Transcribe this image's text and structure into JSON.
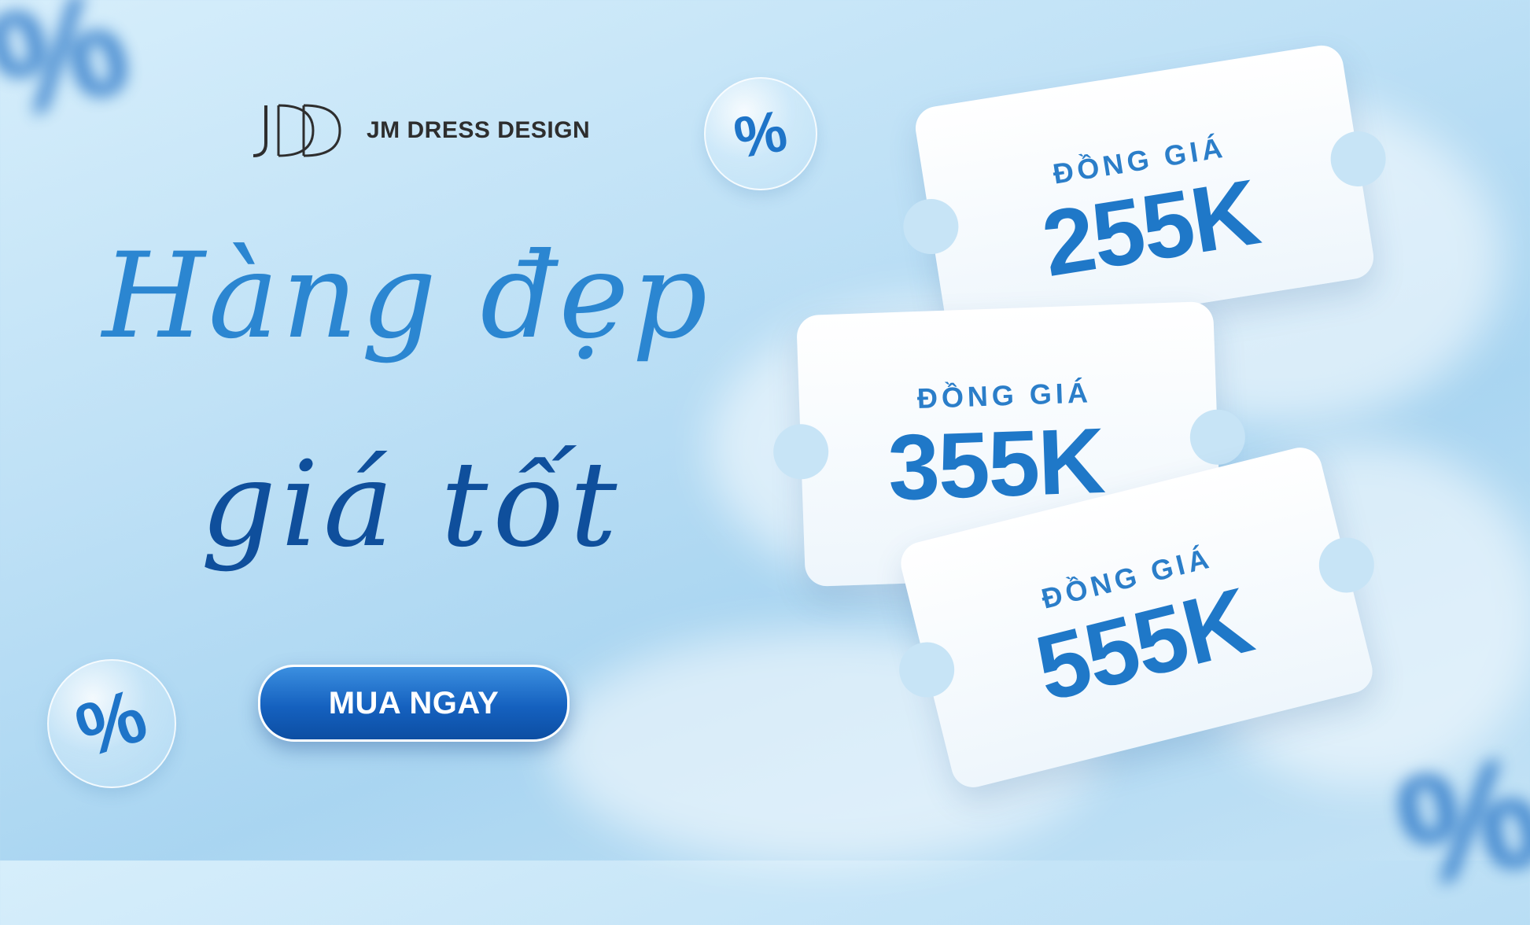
{
  "brand": {
    "name": "JM DRESS DESIGN",
    "mark": "JDD"
  },
  "headline": {
    "line1": "Hàng đẹp",
    "line2": "giá tốt"
  },
  "cta": {
    "label": "MUA NGAY"
  },
  "tickets": [
    {
      "label": "ĐỒNG GIÁ",
      "price": "255K"
    },
    {
      "label": "ĐỒNG GIÁ",
      "price": "355K"
    },
    {
      "label": "ĐỒNG GIÁ",
      "price": "555K"
    }
  ],
  "decor": {
    "percent": "%"
  },
  "colors": {
    "accent": "#1f78c8",
    "dark_blue": "#0f4f9c",
    "sky": "#bfe1f6"
  }
}
